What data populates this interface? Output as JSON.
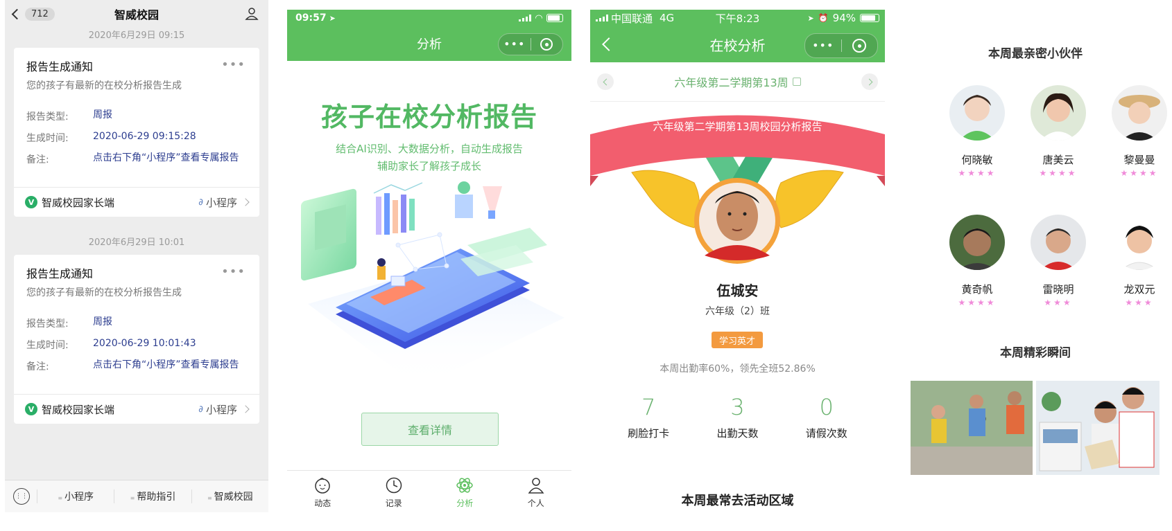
{
  "chat": {
    "back_badge": "712",
    "title": "智威校园",
    "messages": [
      {
        "timestamp": "2020年6月29日 09:15",
        "title": "报告生成通知",
        "subtitle": "您的孩子有最新的在校分析报告生成",
        "rows": [
          {
            "k": "报告类型:",
            "v": "周报"
          },
          {
            "k": "生成时间:",
            "v": "2020-06-29 09:15:28"
          },
          {
            "k": "备注:",
            "v": "点击右下角“小程序”查看专属报告"
          }
        ],
        "footer_app": "智威校园家长端",
        "footer_link": "小程序"
      },
      {
        "timestamp": "2020年6月29日 10:01",
        "title": "报告生成通知",
        "subtitle": "您的孩子有最新的在校分析报告生成",
        "rows": [
          {
            "k": "报告类型:",
            "v": "周报"
          },
          {
            "k": "生成时间:",
            "v": "2020-06-29 10:01:43"
          },
          {
            "k": "备注:",
            "v": "点击右下角“小程序”查看专属报告"
          }
        ],
        "footer_app": "智威校园家长端",
        "footer_link": "小程序"
      }
    ],
    "bottom_menu": [
      "小程序",
      "帮助指引",
      "智威校园"
    ]
  },
  "intro": {
    "status_time": "09:57",
    "nav_title": "分析",
    "headline": "孩子在校分析报告",
    "sub_line1": "结合AI识别、大数据分析，自动生成报告",
    "sub_line2": "辅助家长了解孩子成长",
    "detail_button": "查看详情",
    "tabs": [
      {
        "label": "动态",
        "icon": "baby-face-icon",
        "active": false
      },
      {
        "label": "记录",
        "icon": "clock-icon",
        "active": false
      },
      {
        "label": "分析",
        "icon": "atom-icon",
        "active": true
      },
      {
        "label": "个人",
        "icon": "person-icon",
        "active": false
      }
    ],
    "accent_color": "#5cbf5e"
  },
  "report": {
    "carrier": "中国联通",
    "network": "4G",
    "status_time": "下午8:23",
    "battery": "94%",
    "nav_title": "在校分析",
    "week_label": "六年级第二学期第13周",
    "ribbon_text": "六年级第二学期第13周校园分析报告",
    "student_name": "伍城安",
    "student_class": "六年级（2）班",
    "honor_badge": "学习英才",
    "attendance_note": "本周出勤率60%，领先全班52.86%",
    "stats": [
      {
        "value": "7",
        "label": "刷脸打卡"
      },
      {
        "value": "3",
        "label": "出勤天数"
      },
      {
        "value": "0",
        "label": "请假次数"
      }
    ],
    "area_title": "本周最常去活动区域"
  },
  "friends": {
    "title": "本周最亲密小伙伴",
    "list": [
      {
        "name": "何晓敏",
        "stars": "★★★★"
      },
      {
        "name": "唐美云",
        "stars": "★★★★"
      },
      {
        "name": "黎曼曼",
        "stars": "★★★★"
      },
      {
        "name": "黄奇帆",
        "stars": "★★★★"
      },
      {
        "name": "雷晓明",
        "stars": "★★★"
      },
      {
        "name": "龙双元",
        "stars": "★★★"
      }
    ],
    "moments_title": "本周精彩瞬间"
  }
}
